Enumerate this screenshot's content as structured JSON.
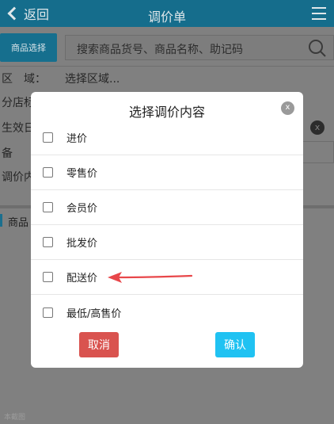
{
  "header": {
    "back_label": "返回",
    "title": "调价单"
  },
  "toolbar": {
    "product_select_label": "商品选择",
    "search_placeholder": "搜索商品货号、商品名称、助记码"
  },
  "form": {
    "area_label": "区　域：",
    "area_value": "选择区域...",
    "branch_label": "分店标",
    "effective_label": "生效日",
    "remark_label": "备",
    "adjust_label": "调价内",
    "clear_symbol": "x"
  },
  "goods_section_label": "商品",
  "watermark": "本截图",
  "modal": {
    "title": "选择调价内容",
    "close_symbol": "x",
    "options": [
      {
        "label": "进价",
        "checked": false
      },
      {
        "label": "零售价",
        "checked": false
      },
      {
        "label": "会员价",
        "checked": false
      },
      {
        "label": "批发价",
        "checked": false
      },
      {
        "label": "配送价",
        "checked": false
      },
      {
        "label": "最低/高售价",
        "checked": false
      }
    ],
    "cancel_label": "取消",
    "confirm_label": "确认"
  },
  "colors": {
    "header_bg": "#156d8c",
    "cancel": "#d9534f",
    "confirm": "#20c2f2",
    "annotation_arrow": "#e8474a"
  },
  "icons": {
    "back": "chevron-left-icon",
    "menu": "hamburger-menu-icon",
    "search": "search-icon",
    "close": "close-icon",
    "annotation": "red-arrow-icon"
  }
}
